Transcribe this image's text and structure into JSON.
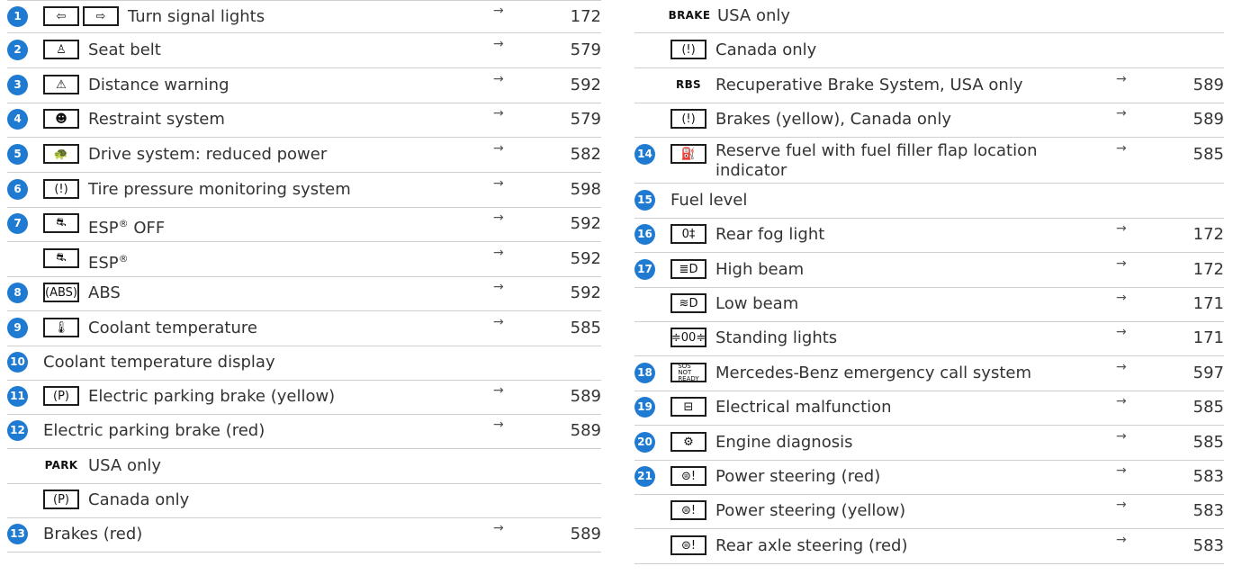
{
  "left_rows": [
    {
      "num": "1",
      "icons": [
        "⇦",
        "⇨"
      ],
      "label": "Turn signal lights",
      "arrow": "→",
      "page": "172"
    },
    {
      "num": "2",
      "icons": [
        "♙"
      ],
      "label": "Seat belt",
      "arrow": "→",
      "page": "579"
    },
    {
      "num": "3",
      "icons": [
        "⚠"
      ],
      "label": "Distance warning",
      "arrow": "→",
      "page": "592"
    },
    {
      "num": "4",
      "icons": [
        "☻"
      ],
      "label": "Restraint system",
      "arrow": "→",
      "page": "579"
    },
    {
      "num": "5",
      "icons": [
        "🐢"
      ],
      "label": "Drive system: reduced power",
      "arrow": "→",
      "page": "582"
    },
    {
      "num": "6",
      "icons": [
        "(!)"
      ],
      "label": "Tire pressure monitoring system",
      "arrow": "→",
      "page": "598"
    },
    {
      "num": "7",
      "icons": [
        "⛐"
      ],
      "label": "ESP® OFF",
      "arrow": "→",
      "page": "592"
    },
    {
      "num": "",
      "icons": [
        "⛐"
      ],
      "label": "ESP®",
      "arrow": "→",
      "page": "592"
    },
    {
      "num": "8",
      "icons": [
        "(ABS)"
      ],
      "label": "ABS",
      "arrow": "→",
      "page": "592"
    },
    {
      "num": "9",
      "icons": [
        "🌡"
      ],
      "label": "Coolant temperature",
      "arrow": "→",
      "page": "585"
    },
    {
      "num": "10",
      "icons": [],
      "label": "Coolant temperature display",
      "arrow": "",
      "page": ""
    },
    {
      "num": "11",
      "icons": [
        "(P)"
      ],
      "label": "Electric parking brake (yellow)",
      "arrow": "→",
      "page": "589"
    },
    {
      "num": "12",
      "icons": [],
      "label": "Electric parking brake (red)",
      "arrow": "→",
      "page": "589"
    },
    {
      "num": "",
      "icons": [
        "PARK"
      ],
      "label": "USA only",
      "arrow": "",
      "page": ""
    },
    {
      "num": "",
      "icons": [
        "(P)"
      ],
      "label": "Canada only",
      "arrow": "",
      "page": ""
    },
    {
      "num": "13",
      "icons": [],
      "label": "Brakes (red)",
      "arrow": "→",
      "page": "589"
    }
  ],
  "right_rows": [
    {
      "num": "",
      "icons": [
        "BRAKE"
      ],
      "label": "USA only",
      "arrow": "",
      "page": ""
    },
    {
      "num": "",
      "icons": [
        "(!)"
      ],
      "label": "Canada only",
      "arrow": "",
      "page": ""
    },
    {
      "num": "",
      "icons": [
        "RBS"
      ],
      "label": "Recuperative Brake System, USA only",
      "arrow": "→",
      "page": "589"
    },
    {
      "num": "",
      "icons": [
        "(!)"
      ],
      "label": "Brakes (yellow), Canada only",
      "arrow": "→",
      "page": "589"
    },
    {
      "num": "14",
      "icons": [
        "⛽"
      ],
      "label": "Reserve fuel with fuel filler flap location indicator",
      "arrow": "→",
      "page": "585"
    },
    {
      "num": "15",
      "icons": [],
      "label": "Fuel level",
      "arrow": "",
      "page": ""
    },
    {
      "num": "16",
      "icons": [
        "0‡"
      ],
      "label": "Rear fog light",
      "arrow": "→",
      "page": "172"
    },
    {
      "num": "17",
      "icons": [
        "≣D"
      ],
      "label": "High beam",
      "arrow": "→",
      "page": "172"
    },
    {
      "num": "",
      "icons": [
        "≋D"
      ],
      "label": "Low beam",
      "arrow": "→",
      "page": "171"
    },
    {
      "num": "",
      "icons": [
        "≑00≑"
      ],
      "label": "Standing lights",
      "arrow": "→",
      "page": "171"
    },
    {
      "num": "18",
      "icons": [
        "SOS NOT READY"
      ],
      "label": "Mercedes-Benz emergency call system",
      "arrow": "→",
      "page": "597"
    },
    {
      "num": "19",
      "icons": [
        "⊟"
      ],
      "label": "Electrical malfunction",
      "arrow": "→",
      "page": "585"
    },
    {
      "num": "20",
      "icons": [
        "⚙"
      ],
      "label": "Engine diagnosis",
      "arrow": "→",
      "page": "585"
    },
    {
      "num": "21",
      "icons": [
        "⊜!"
      ],
      "label": "Power steering (red)",
      "arrow": "→",
      "page": "583"
    },
    {
      "num": "",
      "icons": [
        "⊜!"
      ],
      "label": "Power steering (yellow)",
      "arrow": "→",
      "page": "583"
    },
    {
      "num": "",
      "icons": [
        "⊜!"
      ],
      "label": "Rear axle steering (red)",
      "arrow": "→",
      "page": "583"
    }
  ]
}
